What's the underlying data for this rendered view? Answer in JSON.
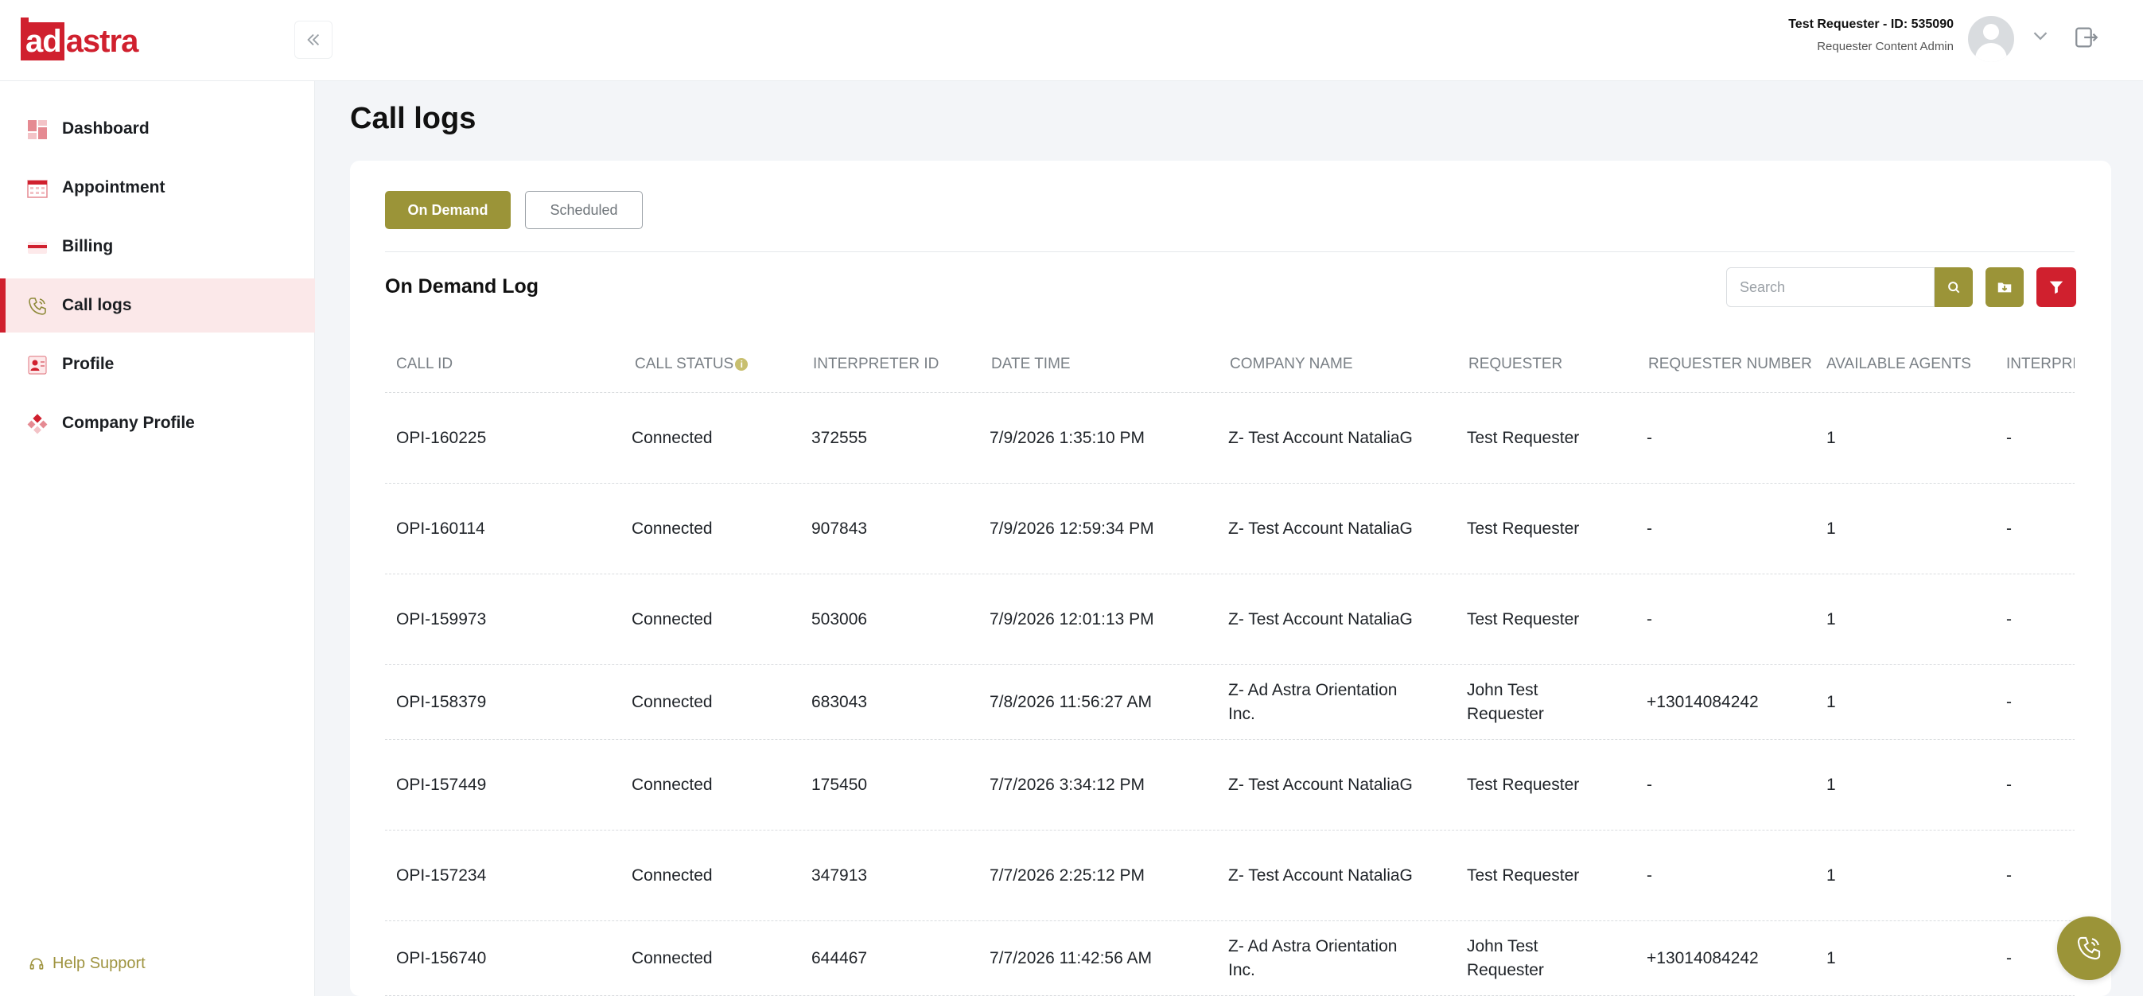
{
  "brand": {
    "logo_ad": "ad",
    "logo_astra": "astra",
    "color": "#d0202e",
    "accent": "#9b9438"
  },
  "header": {
    "collapse_icon": "double-chevron-left-icon",
    "user_name": "Test Requester - ID: 535090",
    "user_role": "Requester Content Admin"
  },
  "sidebar": {
    "items": [
      {
        "label": "Dashboard",
        "icon": "dashboard-icon"
      },
      {
        "label": "Appointment",
        "icon": "calendar-icon"
      },
      {
        "label": "Billing",
        "icon": "billing-card-icon"
      },
      {
        "label": "Call logs",
        "icon": "phone-icon",
        "active": true
      },
      {
        "label": "Profile",
        "icon": "profile-card-icon"
      },
      {
        "label": "Company Profile",
        "icon": "company-icon"
      }
    ],
    "help": "Help Support"
  },
  "page": {
    "title": "Call logs"
  },
  "tabs": {
    "on_demand": "On Demand",
    "scheduled": "Scheduled"
  },
  "log": {
    "title": "On Demand Log",
    "search_placeholder": "Search"
  },
  "table": {
    "headers": [
      "CALL ID",
      "CALL STATUS",
      "INTERPRETER ID",
      "DATE TIME",
      "COMPANY NAME",
      "REQUESTER",
      "REQUESTER NUMBER",
      "AVAILABLE AGENTS",
      "INTERPRE"
    ],
    "rows": [
      [
        "OPI-160225",
        "Connected",
        "372555",
        "7/9/2026 1:35:10 PM",
        "Z- Test Account NataliaG",
        "Test Requester",
        "-",
        "1",
        "-"
      ],
      [
        "OPI-160114",
        "Connected",
        "907843",
        "7/9/2026 12:59:34 PM",
        "Z- Test Account NataliaG",
        "Test Requester",
        "-",
        "1",
        "-"
      ],
      [
        "OPI-159973",
        "Connected",
        "503006",
        "7/9/2026 12:01:13 PM",
        "Z- Test Account NataliaG",
        "Test Requester",
        "-",
        "1",
        "-"
      ],
      [
        "OPI-158379",
        "Connected",
        "683043",
        "7/8/2026 11:56:27 AM",
        "Z- Ad Astra Orientation Inc.",
        "John Test Requester",
        "+13014084242",
        "1",
        "-"
      ],
      [
        "OPI-157449",
        "Connected",
        "175450",
        "7/7/2026 3:34:12 PM",
        "Z- Test Account NataliaG",
        "Test Requester",
        "-",
        "1",
        "-"
      ],
      [
        "OPI-157234",
        "Connected",
        "347913",
        "7/7/2026 2:25:12 PM",
        "Z- Test Account NataliaG",
        "Test Requester",
        "-",
        "1",
        "-"
      ],
      [
        "OPI-156740",
        "Connected",
        "644467",
        "7/7/2026 11:42:56 AM",
        "Z- Ad Astra Orientation Inc.",
        "John Test Requester",
        "+13014084242",
        "1",
        "-"
      ]
    ]
  }
}
